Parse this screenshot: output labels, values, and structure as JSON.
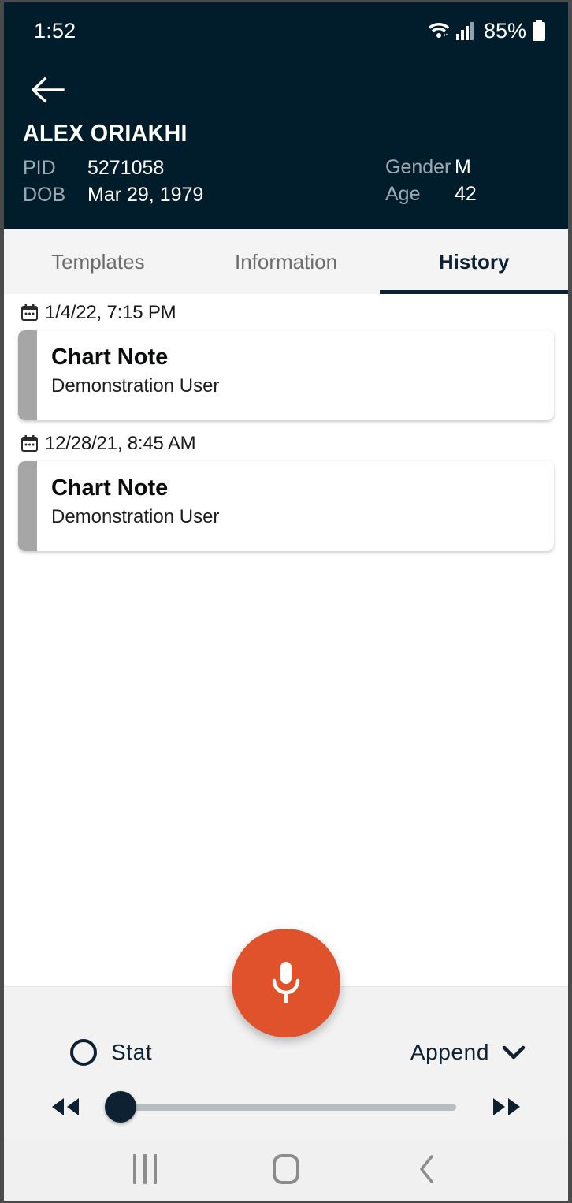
{
  "status_bar": {
    "time": "1:52",
    "battery_percent": "85%",
    "wifi_icon": "wifi-icon",
    "signal_icon": "cellular-signal-icon",
    "battery_icon": "battery-icon"
  },
  "header": {
    "back_icon": "arrow-left-icon",
    "patient_name": "ALEX ORIAKHI",
    "fields_left": [
      {
        "label": "PID",
        "value": "5271058"
      },
      {
        "label": "DOB",
        "value": "Mar 29, 1979"
      }
    ],
    "fields_right": [
      {
        "label": "Gender",
        "value": "M"
      },
      {
        "label": "Age",
        "value": "42"
      }
    ],
    "background_color": "#011D2B"
  },
  "tabs": [
    {
      "label": "Templates",
      "active": false
    },
    {
      "label": "Information",
      "active": false
    },
    {
      "label": "History",
      "active": true
    }
  ],
  "history": [
    {
      "date": "1/4/22, 7:15 PM",
      "calendar_icon": "calendar-icon",
      "title": "Chart Note",
      "author": "Demonstration User",
      "accent_color": "#A6A6A6"
    },
    {
      "date": "12/28/21, 8:45 AM",
      "calendar_icon": "calendar-icon",
      "title": "Chart Note",
      "author": "Demonstration User",
      "accent_color": "#A6A6A6"
    }
  ],
  "bottom_controls": {
    "mic_icon": "microphone-icon",
    "mic_color": "#E0522C",
    "stat_label": "Stat",
    "stat_radio_icon": "radio-unchecked-icon",
    "stat_selected": false,
    "append_label": "Append",
    "append_chevron_icon": "chevron-down-icon",
    "rewind_icon": "rewind-icon",
    "forward_icon": "fast-forward-icon",
    "slider_value": 0
  },
  "android_nav": {
    "recents_icon": "recents-icon",
    "home_icon": "home-icon",
    "back_icon": "chevron-left-icon"
  }
}
